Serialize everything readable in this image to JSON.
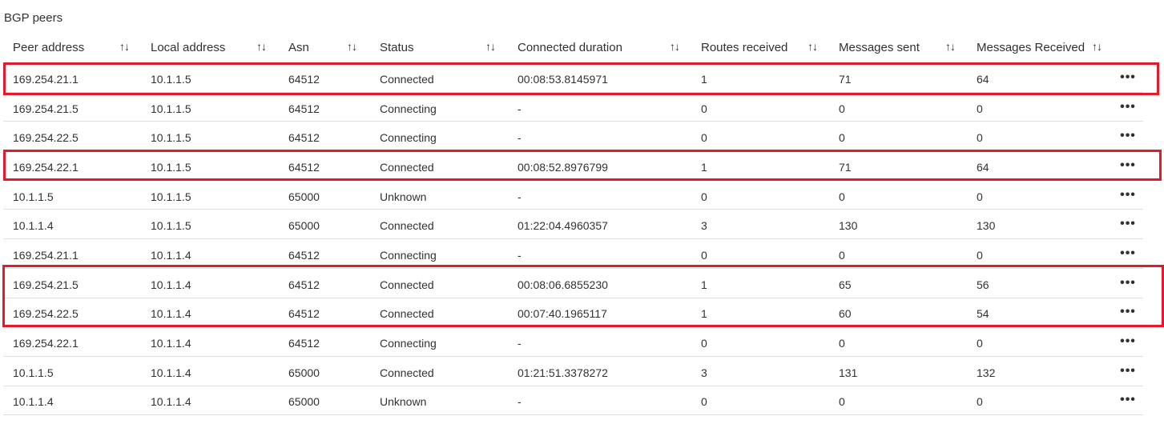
{
  "section_title": "BGP peers",
  "columns": [
    {
      "key": "peer",
      "label": "Peer address"
    },
    {
      "key": "local",
      "label": "Local address"
    },
    {
      "key": "asn",
      "label": "Asn"
    },
    {
      "key": "status",
      "label": "Status"
    },
    {
      "key": "duration",
      "label": "Connected duration"
    },
    {
      "key": "routes",
      "label": "Routes received"
    },
    {
      "key": "sent",
      "label": "Messages sent"
    },
    {
      "key": "received",
      "label": "Messages Received"
    }
  ],
  "sort_glyph": "↑↓",
  "more_glyph": "•••",
  "highlight_color": "#e21a2c",
  "rows": [
    {
      "peer": "169.254.21.1",
      "local": "10.1.1.5",
      "asn": "64512",
      "status": "Connected",
      "duration": "00:08:53.8145971",
      "routes": "1",
      "sent": "71",
      "received": "64"
    },
    {
      "peer": "169.254.21.5",
      "local": "10.1.1.5",
      "asn": "64512",
      "status": "Connecting",
      "duration": "-",
      "routes": "0",
      "sent": "0",
      "received": "0"
    },
    {
      "peer": "169.254.22.5",
      "local": "10.1.1.5",
      "asn": "64512",
      "status": "Connecting",
      "duration": "-",
      "routes": "0",
      "sent": "0",
      "received": "0"
    },
    {
      "peer": "169.254.22.1",
      "local": "10.1.1.5",
      "asn": "64512",
      "status": "Connected",
      "duration": "00:08:52.8976799",
      "routes": "1",
      "sent": "71",
      "received": "64"
    },
    {
      "peer": "10.1.1.5",
      "local": "10.1.1.5",
      "asn": "65000",
      "status": "Unknown",
      "duration": "-",
      "routes": "0",
      "sent": "0",
      "received": "0"
    },
    {
      "peer": "10.1.1.4",
      "local": "10.1.1.5",
      "asn": "65000",
      "status": "Connected",
      "duration": "01:22:04.4960357",
      "routes": "3",
      "sent": "130",
      "received": "130"
    },
    {
      "peer": "169.254.21.1",
      "local": "10.1.1.4",
      "asn": "64512",
      "status": "Connecting",
      "duration": "-",
      "routes": "0",
      "sent": "0",
      "received": "0"
    },
    {
      "peer": "169.254.21.5",
      "local": "10.1.1.4",
      "asn": "64512",
      "status": "Connected",
      "duration": "00:08:06.6855230",
      "routes": "1",
      "sent": "65",
      "received": "56"
    },
    {
      "peer": "169.254.22.5",
      "local": "10.1.1.4",
      "asn": "64512",
      "status": "Connected",
      "duration": "00:07:40.1965117",
      "routes": "1",
      "sent": "60",
      "received": "54"
    },
    {
      "peer": "169.254.22.1",
      "local": "10.1.1.4",
      "asn": "64512",
      "status": "Connecting",
      "duration": "-",
      "routes": "0",
      "sent": "0",
      "received": "0"
    },
    {
      "peer": "10.1.1.5",
      "local": "10.1.1.4",
      "asn": "65000",
      "status": "Connected",
      "duration": "01:21:51.3378272",
      "routes": "3",
      "sent": "131",
      "received": "132"
    },
    {
      "peer": "10.1.1.4",
      "local": "10.1.1.4",
      "asn": "65000",
      "status": "Unknown",
      "duration": "-",
      "routes": "0",
      "sent": "0",
      "received": "0"
    }
  ]
}
